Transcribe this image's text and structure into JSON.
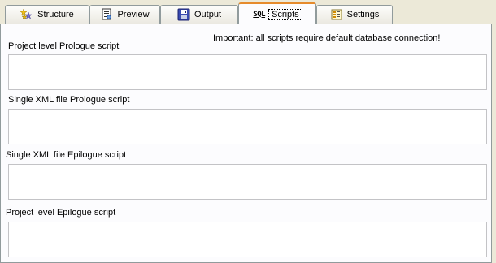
{
  "tabs": [
    {
      "label": "Structure",
      "icon": "structure-icon",
      "active": false
    },
    {
      "label": "Preview",
      "icon": "preview-document-icon",
      "active": false
    },
    {
      "label": "Output",
      "icon": "floppy-disk-icon",
      "active": false
    },
    {
      "label": "Scripts",
      "icon": "sql-icon",
      "icon_text": "SQL",
      "active": true
    },
    {
      "label": "Settings",
      "icon": "settings-sheet-icon",
      "active": false
    }
  ],
  "scripts_panel": {
    "notice": "Important: all scripts require default database connection!",
    "fields": [
      {
        "label": "Project level Prologue script",
        "value": ""
      },
      {
        "label": "Single XML file Prologue script",
        "value": ""
      },
      {
        "label": "Single XML file Epilogue script",
        "value": ""
      },
      {
        "label": "Project level Epilogue script",
        "value": ""
      }
    ]
  },
  "colors": {
    "background": "#ece9d8",
    "active_tab_accent": "#e68b2c",
    "border": "#919b9c"
  }
}
